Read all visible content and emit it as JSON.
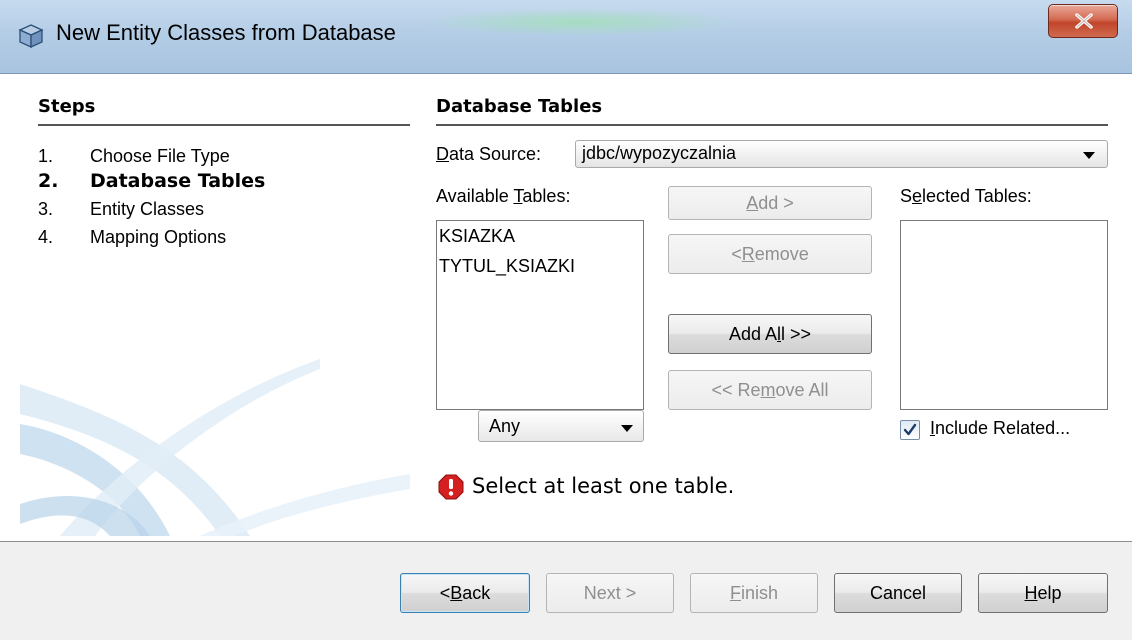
{
  "window": {
    "title": "New Entity Classes from Database",
    "close_label": "Close",
    "icon": "cube-icon"
  },
  "steps": {
    "title": "Steps",
    "items": [
      {
        "num": "1.",
        "label": "Choose File Type",
        "active": false
      },
      {
        "num": "2.",
        "label": "Database Tables",
        "active": true
      },
      {
        "num": "3.",
        "label": "Entity Classes",
        "active": false
      },
      {
        "num": "4.",
        "label": "Mapping Options",
        "active": false
      }
    ]
  },
  "main": {
    "title": "Database Tables",
    "data_source": {
      "label_mnemonic": "D",
      "label_rest": "ata Source:",
      "value": "jdbc/wypozyczalnia"
    },
    "available": {
      "label_prefix": "Available ",
      "label_mnemonic": "T",
      "label_rest": "ables:",
      "items": [
        "KSIAZKA",
        "TYTUL_KSIAZKI"
      ]
    },
    "selected": {
      "label_prefix": "S",
      "label_mnemonic": "e",
      "label_rest": "lected Tables:",
      "items": []
    },
    "buttons": {
      "add_mnemonic": "A",
      "add_rest": "dd >",
      "remove_prefix": "< ",
      "remove_mnemonic": "R",
      "remove_rest": "emove",
      "add_all_prefix": "Add A",
      "add_all_mnemonic": "l",
      "add_all_rest": "l >>",
      "remove_all_prefix": "<< Re",
      "remove_all_mnemonic": "m",
      "remove_all_rest": "ove All"
    },
    "filter": {
      "value": "Any"
    },
    "include_related": {
      "checked": true,
      "label_mnemonic": "I",
      "label_rest": "nclude Related..."
    },
    "error": {
      "icon": "error-icon",
      "text": "Select at least one table."
    }
  },
  "footer": {
    "back_prefix": "< ",
    "back_mnemonic": "B",
    "back_rest": "ack",
    "next": "Next >",
    "finish_mnemonic": "F",
    "finish_rest": "inish",
    "cancel": "Cancel",
    "help_mnemonic": "H",
    "help_rest": "elp"
  },
  "colors": {
    "titlebar": "#b4cde6",
    "close_button": "#c1452b",
    "error": "#d42020",
    "checkmark": "#1b3e6b"
  }
}
